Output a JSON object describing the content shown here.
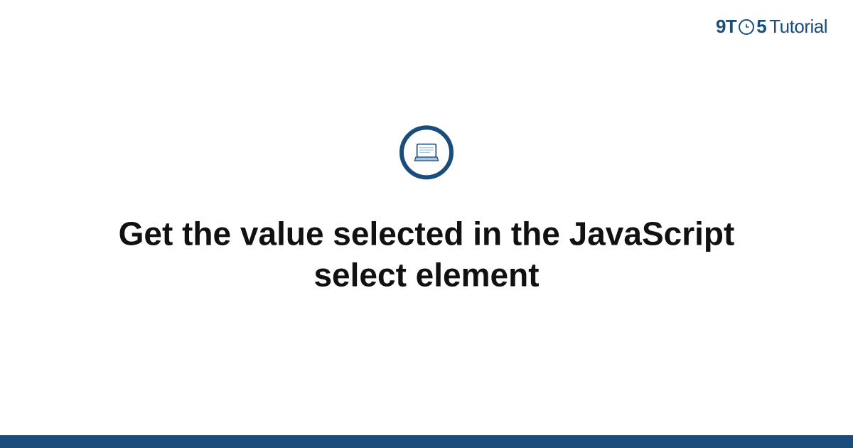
{
  "logo": {
    "part1": "9T",
    "part2": "5",
    "part3": "Tutorial"
  },
  "title": "Get the value selected in the JavaScript select element",
  "colors": {
    "brand": "#1a4d7a",
    "accent_light": "#a8c4e0"
  }
}
